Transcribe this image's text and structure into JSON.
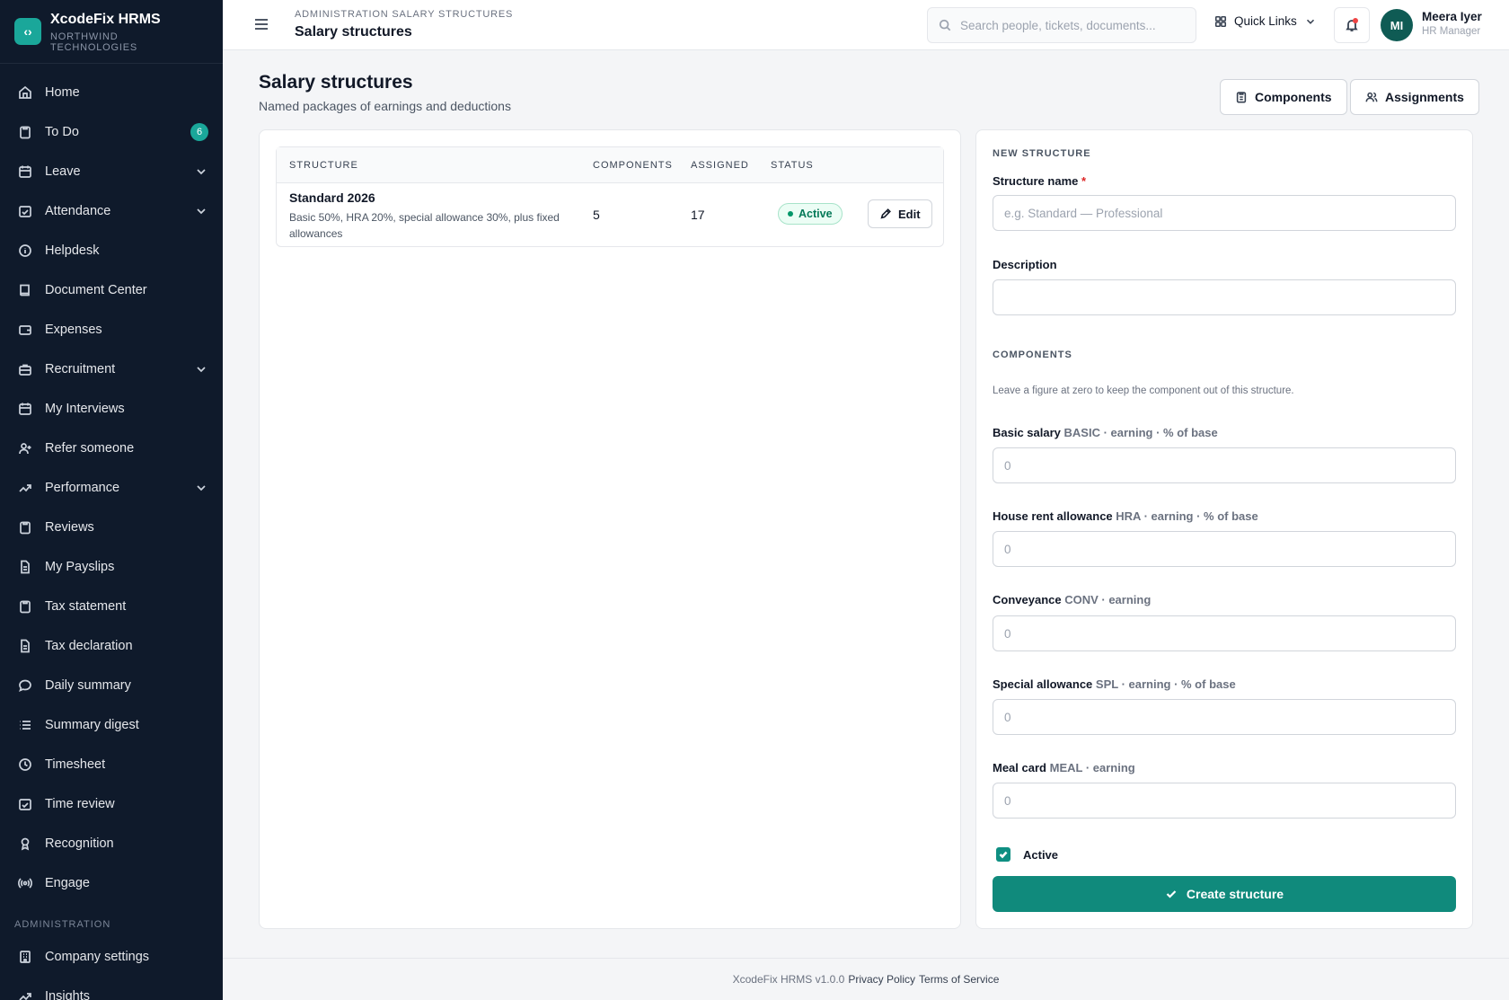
{
  "brand": {
    "name": "XcodeFix HRMS",
    "company": "NORTHWIND TECHNOLOGIES"
  },
  "sidebar": {
    "items": [
      {
        "label": "Home"
      },
      {
        "label": "To Do",
        "badge": "6"
      },
      {
        "label": "Leave"
      },
      {
        "label": "Attendance"
      },
      {
        "label": "Helpdesk"
      },
      {
        "label": "Document Center"
      },
      {
        "label": "Expenses"
      },
      {
        "label": "Recruitment"
      },
      {
        "label": "My Interviews"
      },
      {
        "label": "Refer someone"
      },
      {
        "label": "Performance"
      },
      {
        "label": "Reviews"
      },
      {
        "label": "My Payslips"
      },
      {
        "label": "Tax statement"
      },
      {
        "label": "Tax declaration"
      },
      {
        "label": "Daily summary"
      },
      {
        "label": "Summary digest"
      },
      {
        "label": "Timesheet"
      },
      {
        "label": "Time review"
      },
      {
        "label": "Recognition"
      },
      {
        "label": "Engage"
      }
    ],
    "section_label": "ADMINISTRATION",
    "admin_items": [
      {
        "label": "Company settings"
      },
      {
        "label": "Insights"
      }
    ]
  },
  "header": {
    "breadcrumb": "ADMINISTRATION SALARY STRUCTURES",
    "title": "Salary structures",
    "search_placeholder": "Search people, tickets, documents...",
    "quick_links": "Quick Links",
    "user": {
      "initials": "MI",
      "name": "Meera Iyer",
      "role": "HR Manager"
    }
  },
  "page": {
    "title": "Salary structures",
    "subtitle": "Named packages of earnings and deductions",
    "components_button": "Components",
    "assignments_button": "Assignments"
  },
  "table": {
    "columns": [
      "STRUCTURE",
      "COMPONENTS",
      "ASSIGNED",
      "STATUS"
    ],
    "rows": [
      {
        "name": "Standard 2026",
        "description": "Basic 50%, HRA 20%, special allowance 30%, plus fixed allowances",
        "components": "5",
        "assigned": "17",
        "status": "Active",
        "action": "Edit"
      }
    ]
  },
  "form": {
    "section_title": "NEW STRUCTURE",
    "name_label": "Structure name",
    "name_required": "*",
    "name_placeholder": "e.g. Standard — Professional",
    "description_label": "Description",
    "description_value": "",
    "components_title": "COMPONENTS",
    "components_hint": "Leave a figure at zero to keep the component out of this structure.",
    "components": [
      {
        "name": "Basic salary",
        "meta": "BASIC · earning · % of base",
        "value": "",
        "placeholder": "0"
      },
      {
        "name": "House rent allowance",
        "meta": "HRA · earning · % of base",
        "value": "",
        "placeholder": "0"
      },
      {
        "name": "Conveyance",
        "meta": "CONV · earning",
        "value": "",
        "placeholder": "0"
      },
      {
        "name": "Special allowance",
        "meta": "SPL · earning · % of base",
        "value": "",
        "placeholder": "0"
      },
      {
        "name": "Meal card",
        "meta": "MEAL · earning",
        "value": "",
        "placeholder": "0"
      }
    ],
    "active_label": "Active",
    "submit_label": "Create structure"
  },
  "footer": {
    "version": "XcodeFix HRMS v1.0.0",
    "privacy": "Privacy Policy",
    "terms": "Terms of Service"
  },
  "colors": {
    "sidebar_bg": "#0f1a2b",
    "accent": "#108a7c",
    "active_status": "#047857",
    "required": "#dc2626"
  }
}
